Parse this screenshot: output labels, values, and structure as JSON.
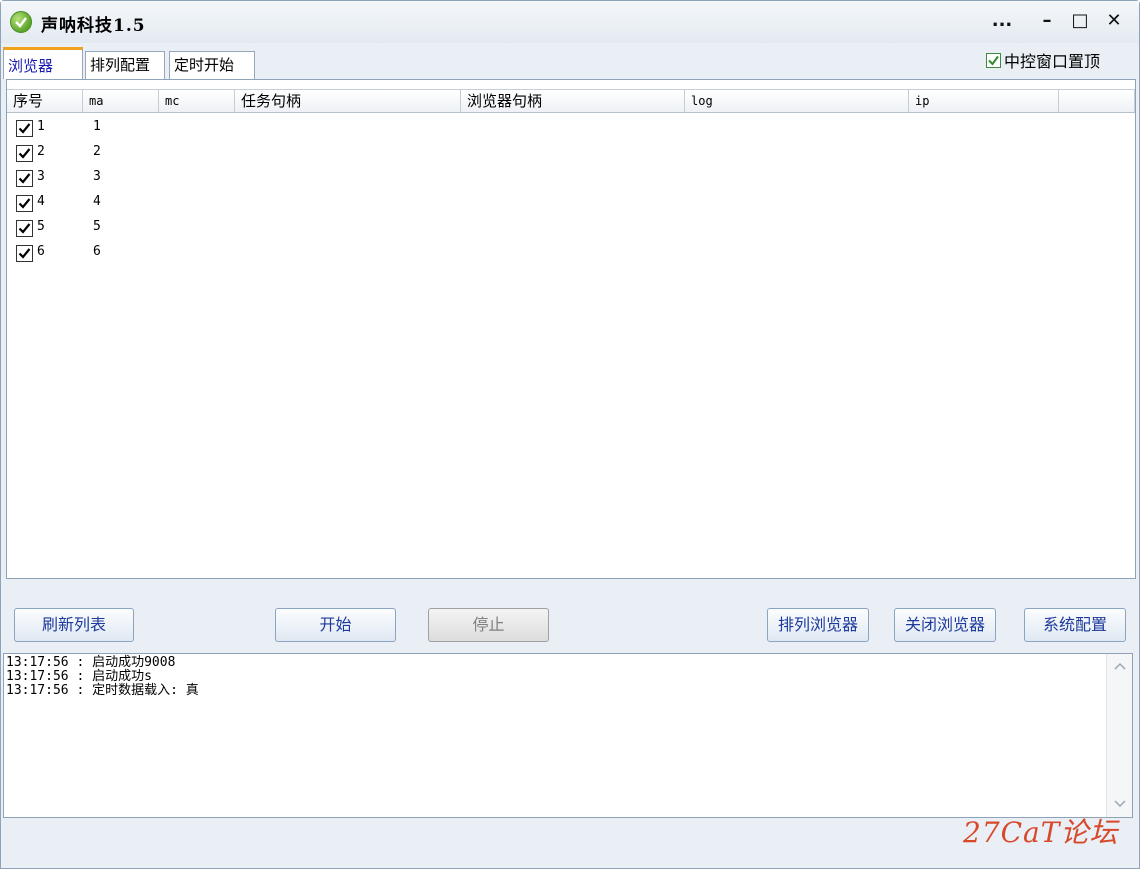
{
  "window": {
    "title": "声呐科技1.5",
    "controls": {
      "more": "...",
      "minimize": "–",
      "maximize": "□",
      "close": "✕"
    }
  },
  "tabs": [
    {
      "label": "浏览器",
      "active": true
    },
    {
      "label": "排列配置",
      "active": false
    },
    {
      "label": "定时开始",
      "active": false
    }
  ],
  "topmost": {
    "label": "中控窗口置顶",
    "checked": true
  },
  "table": {
    "columns": [
      "序号",
      "ma",
      "mc",
      "任务句柄",
      "浏览器句柄",
      "log",
      "ip",
      ""
    ],
    "rows": [
      {
        "index": "1",
        "ma": "1",
        "checked": true
      },
      {
        "index": "2",
        "ma": "2",
        "checked": true
      },
      {
        "index": "3",
        "ma": "3",
        "checked": true
      },
      {
        "index": "4",
        "ma": "4",
        "checked": true
      },
      {
        "index": "5",
        "ma": "5",
        "checked": true
      },
      {
        "index": "6",
        "ma": "6",
        "checked": true
      }
    ]
  },
  "buttons": {
    "refresh": "刷新列表",
    "start": "开始",
    "stop": "停止",
    "arrange": "排列浏览器",
    "close_browser": "关闭浏览器",
    "settings": "系统配置"
  },
  "log": [
    "13:17:56 : 启动成功9008",
    "13:17:56 : 启动成功s",
    "13:17:56 : 定时数据载入: 真"
  ],
  "watermark": "27CaT论坛",
  "colors": {
    "accent": "#f0a21a",
    "button_text": "#1d3a9c",
    "watermark": "#d8482a"
  }
}
